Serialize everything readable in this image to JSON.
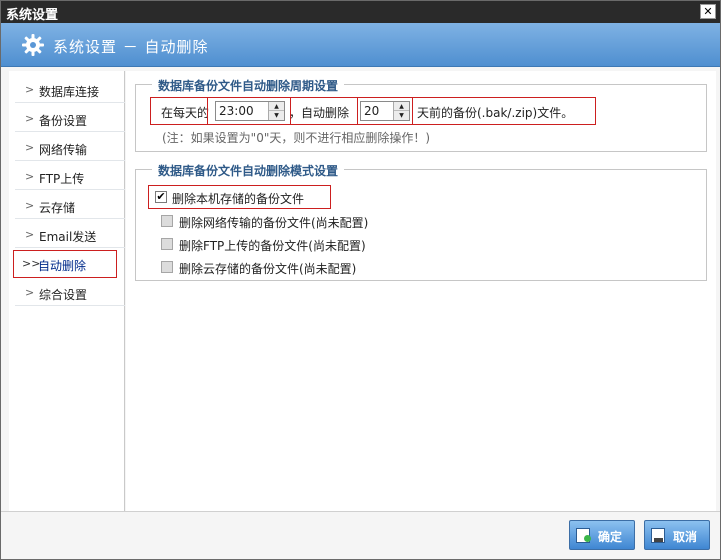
{
  "window": {
    "title": "系统设置",
    "close_glyph": "✕"
  },
  "banner": {
    "title": "系统设置 － 自动删除",
    "icon": "gear-icon"
  },
  "sidebar": {
    "items": [
      {
        "label": "数据库连接",
        "chevron": ">"
      },
      {
        "label": "备份设置",
        "chevron": ">"
      },
      {
        "label": "网络传输",
        "chevron": ">"
      },
      {
        "label": "FTP上传",
        "chevron": ">"
      },
      {
        "label": "云存储",
        "chevron": ">"
      },
      {
        "label": "Email发送",
        "chevron": ">"
      },
      {
        "label": "自动删除",
        "chevron": ">>",
        "active": true
      },
      {
        "label": "综合设置",
        "chevron": ">"
      }
    ]
  },
  "period": {
    "legend": "数据库备份文件自动删除周期设置",
    "prefix": "在每天的",
    "time_value": "23:00",
    "middle": "，自动删除",
    "days_value": "20",
    "suffix": "天前的备份(.bak/.zip)文件。",
    "note": "(注：如果设置为\"0\"天，则不进行相应删除操作！)"
  },
  "mode": {
    "legend": "数据库备份文件自动删除模式设置",
    "options": [
      {
        "label": "删除本机存储的备份文件",
        "checked": true,
        "enabled": true
      },
      {
        "label": "删除网络传输的备份文件(尚未配置)",
        "checked": false,
        "enabled": false
      },
      {
        "label": "删除FTP上传的备份文件(尚未配置)",
        "checked": false,
        "enabled": false
      },
      {
        "label": "删除云存储的备份文件(尚未配置)",
        "checked": false,
        "enabled": false
      }
    ]
  },
  "footer": {
    "ok_label": "确定",
    "cancel_label": "取消"
  },
  "glyphs": {
    "check": "✔",
    "up": "▲",
    "down": "▼"
  },
  "colors": {
    "banner": "#5a97d6",
    "highlight": "#cc1f1f",
    "legend": "#2f5a88",
    "button": "#3f86d2"
  }
}
